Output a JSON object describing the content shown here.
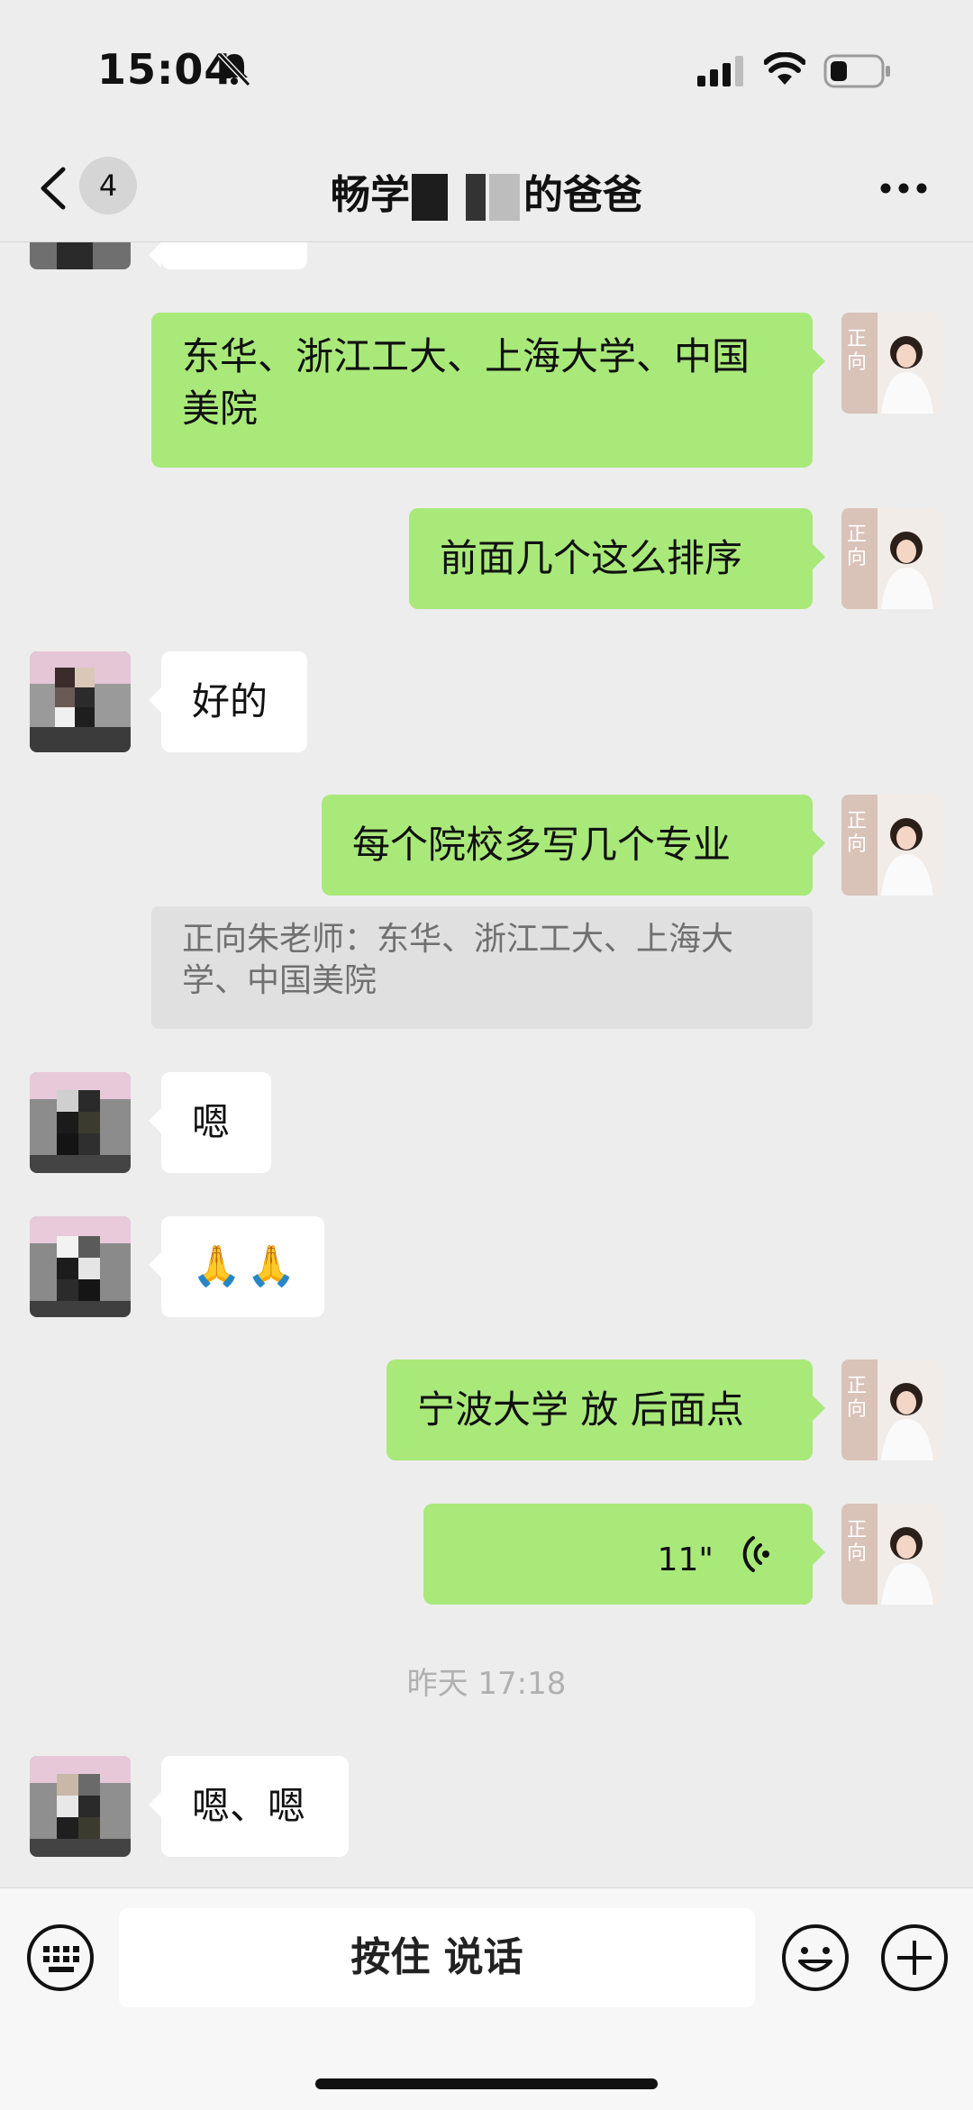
{
  "status_bar": {
    "time": "15:04",
    "icons": [
      "bell-muted-icon",
      "cellular-signal-icon",
      "wifi-icon",
      "battery-icon"
    ]
  },
  "nav": {
    "unread_count": "4",
    "title_start": "畅",
    "title_mid": "学",
    "title_end": "的爸爸",
    "icons": [
      "chevron-left-icon",
      "more-icon"
    ]
  },
  "messages": {
    "m1": "东华、浙江工大、上海大学、中国美院",
    "m2": "前面几个这么排序",
    "m3": "好的",
    "m4": "每个院校多写几个专业",
    "m4_quote": "正向朱老师：东华、浙江工大、上海大学、中国美院",
    "m5": "嗯",
    "m6": "🙏🙏",
    "m7": "宁波大学 放 后面点",
    "m8_voice": "11\"",
    "timestamp": "昨天 17:18",
    "m9": "嗯、嗯"
  },
  "input_bar": {
    "talk_label": "按住 说话",
    "icons": [
      "keyboard-icon",
      "emoji-icon",
      "plus-icon"
    ]
  },
  "colors": {
    "background": "#ededed",
    "outgoing_bubble": "#a9e97a",
    "incoming_bubble": "#ffffff",
    "quote_bg": "#e0e0e0"
  }
}
